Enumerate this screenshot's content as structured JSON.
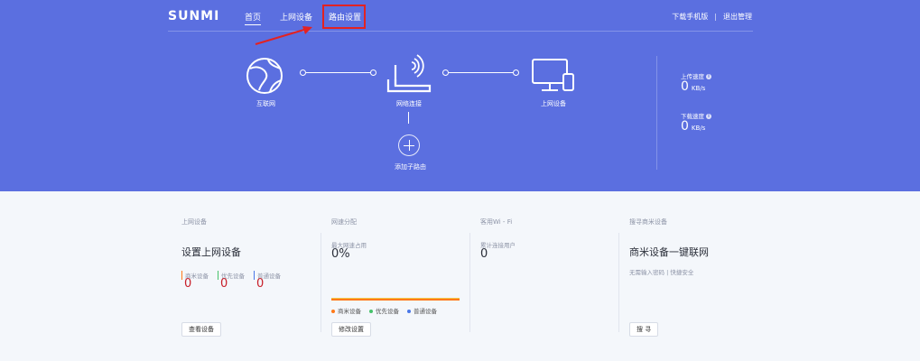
{
  "nav": {
    "logo": "SUNMI",
    "home": "首页",
    "devices": "上网设备",
    "router_settings": "路由设置",
    "download_app": "下载手机版",
    "separator": "|",
    "logout": "退出管理"
  },
  "topology": {
    "internet": "互联网",
    "network_connection": "网络连接",
    "online_devices": "上网设备",
    "add_subrouter": "添加子路由"
  },
  "speed": {
    "upload_label": "上传速度",
    "upload_value": "0",
    "upload_unit": "KB/s",
    "download_label": "下载速度",
    "download_value": "0",
    "download_unit": "KB/s",
    "info": "i"
  },
  "panels": {
    "devices": {
      "title": "上网设备",
      "heading": "设置上网设备",
      "commercial_label": "商米设备",
      "commercial_value": "0",
      "priority_label": "优先设备",
      "priority_value": "0",
      "normal_label": "普通设备",
      "normal_value": "0",
      "button": "查看设备"
    },
    "bandwidth": {
      "title": "网速分配",
      "max_label": "最大网速占用",
      "max_value": "0%",
      "legend_commercial": "商米设备",
      "legend_priority": "优先设备",
      "legend_normal": "普通设备",
      "button": "修改设置"
    },
    "guest": {
      "title": "客用Wi - Fi",
      "users_label": "累计连接用户",
      "users_value": "0"
    },
    "search": {
      "title": "搜寻商米设备",
      "heading": "商米设备一键联网",
      "desc": "无需输入密码 | 快捷安全",
      "button": "搜 寻"
    }
  },
  "colors": {
    "hero": "#5b6fe0",
    "highlight_box": "#e32222",
    "commercial": "#ff7a1a",
    "priority": "#47c26b",
    "normal": "#4a78e8",
    "count": "#c8202a"
  }
}
